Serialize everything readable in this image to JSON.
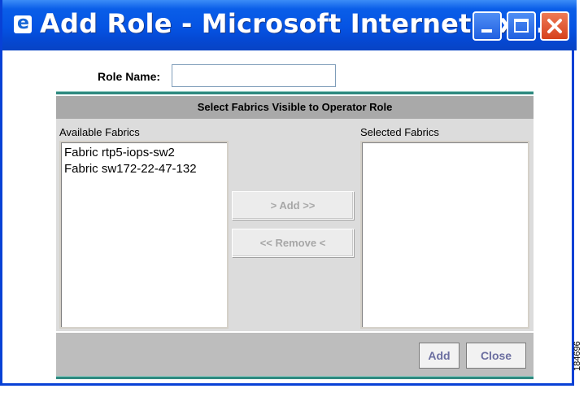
{
  "window": {
    "title": "Add Role - Microsoft Internet Ex...",
    "icon": "ie-icon"
  },
  "form": {
    "role_name_label": "Role Name:",
    "role_name_value": "",
    "panel_title": "Select Fabrics Visible to Operator Role",
    "available_label": "Available Fabrics",
    "selected_label": "Selected Fabrics",
    "available_items": [
      "Fabric rtp5-iops-sw2",
      "Fabric sw172-22-47-132"
    ],
    "selected_items": [],
    "add_move_label": ">   Add   >>",
    "remove_move_label": "<< Remove  <",
    "add_button": "Add",
    "close_button": "Close"
  },
  "colors": {
    "titlebar": "#0553e3",
    "accent_rule": "#2f8a80",
    "panel_bg": "#dcdcdc",
    "panel_header": "#a9a9a9"
  },
  "figure_id": "184696"
}
